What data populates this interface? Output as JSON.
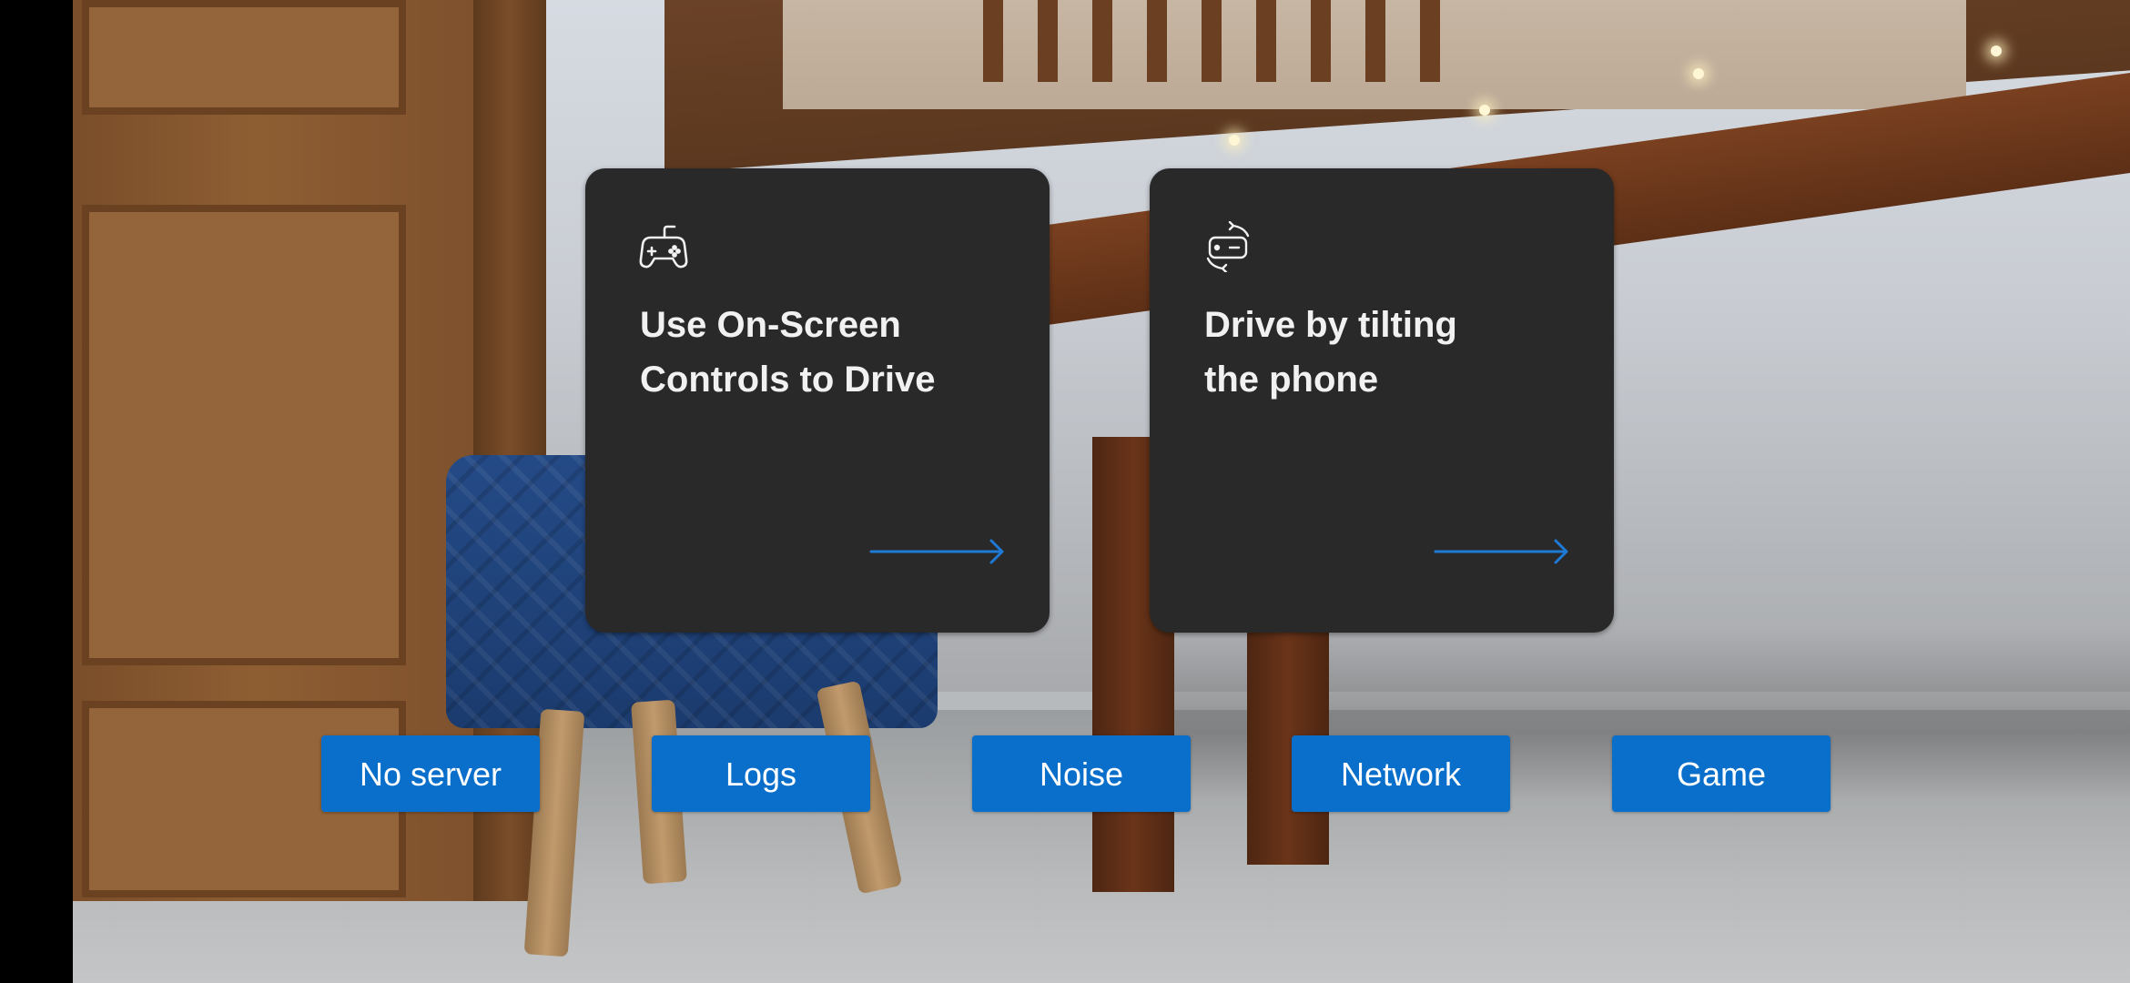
{
  "cards": [
    {
      "icon": "gamepad-icon",
      "title_line1": "Use On-Screen",
      "title_line2": "Controls to Drive",
      "arrow": "arrow-right-icon"
    },
    {
      "icon": "phone-rotate-icon",
      "title_line1": "Drive by tilting",
      "title_line2": "the phone",
      "arrow": "arrow-right-icon"
    }
  ],
  "buttons": {
    "no_server": "No server",
    "logs": "Logs",
    "noise": "Noise",
    "network": "Network",
    "game": "Game"
  },
  "colors": {
    "card_background": "#292929",
    "accent_blue": "#0a6fcb",
    "arrow_blue": "#1f7ad6",
    "text_white": "#f1f1f1"
  }
}
